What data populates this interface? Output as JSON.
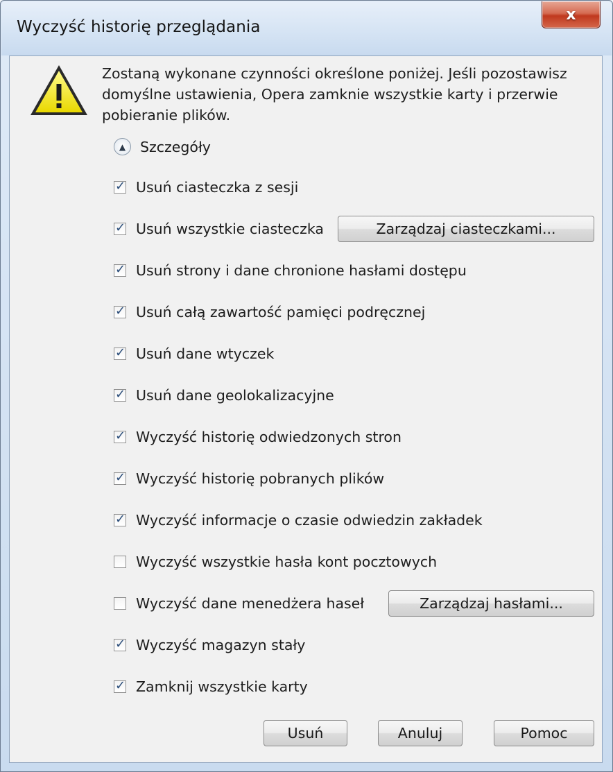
{
  "window": {
    "title": "Wyczyść historię przeglądania",
    "close_glyph": "x"
  },
  "message": "Zostaną wykonane czynności określone poniżej. Jeśli pozostawisz domyślne ustawienia, Opera zamknie wszystkie karty i przerwie pobieranie plików.",
  "details": {
    "label": "Szczegóły",
    "icon": "chevron-up-icon"
  },
  "options": [
    {
      "label": "Usuń ciasteczka z sesji",
      "checked": true
    },
    {
      "label": "Usuń wszystkie ciasteczka",
      "checked": true
    },
    {
      "label": "Usuń strony i dane chronione hasłami dostępu",
      "checked": true
    },
    {
      "label": "Usuń całą zawartość pamięci podręcznej",
      "checked": true
    },
    {
      "label": "Usuń dane wtyczek",
      "checked": true
    },
    {
      "label": "Usuń dane geolokalizacyjne",
      "checked": true
    },
    {
      "label": "Wyczyść historię odwiedzonych stron",
      "checked": true
    },
    {
      "label": "Wyczyść historię pobranych plików",
      "checked": true
    },
    {
      "label": "Wyczyść informacje o czasie odwiedzin zakładek",
      "checked": true
    },
    {
      "label": "Wyczyść wszystkie hasła kont pocztowych",
      "checked": false
    },
    {
      "label": "Wyczyść dane menedżera haseł",
      "checked": false
    },
    {
      "label": "Wyczyść magazyn stały",
      "checked": true
    },
    {
      "label": "Zamknij wszystkie karty",
      "checked": true
    }
  ],
  "buttons": {
    "manage_cookies": "Zarządzaj ciasteczkami...",
    "manage_passwords": "Zarządzaj hasłami...",
    "delete": "Usuń",
    "cancel": "Anuluj",
    "help": "Pomoc"
  },
  "colors": {
    "warning_yellow": "#f2e400",
    "close_red": "#c8432a"
  }
}
